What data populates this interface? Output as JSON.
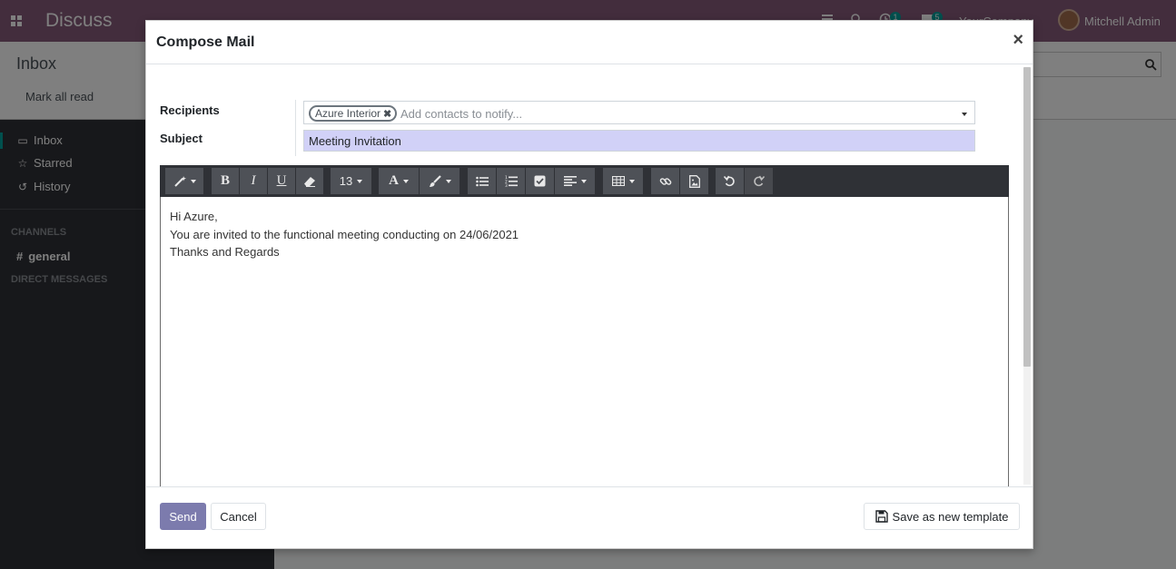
{
  "app": {
    "title": "Discuss",
    "company": "YourCompany",
    "user_name": "Mitchell Admin",
    "activity_count": "1",
    "messages_count": "5"
  },
  "control_panel": {
    "title": "Inbox",
    "mark_all_read": "Mark all read"
  },
  "sidebar": {
    "items": [
      {
        "label": "Inbox",
        "icon": "inbox-icon"
      },
      {
        "label": "Starred",
        "icon": "star-icon"
      },
      {
        "label": "History",
        "icon": "history-icon"
      }
    ],
    "channels_header": "CHANNELS",
    "channel": "general",
    "dm_header": "DIRECT MESSAGES"
  },
  "modal": {
    "title": "Compose Mail",
    "close_glyph": "×",
    "recipients_label": "Recipients",
    "recipient_tag": "Azure Interior",
    "recipients_placeholder": "Add contacts to notify...",
    "subject_label": "Subject",
    "subject_value": "Meeting Invitation",
    "font_size": "13",
    "body_lines": [
      "Hi Azure,",
      "You are invited to the functional meeting conducting on 24/06/2021",
      "Thanks and Regards"
    ],
    "send_label": "Send",
    "cancel_label": "Cancel",
    "save_template_label": "Save as new template"
  },
  "colors": {
    "brand": "#875a7b",
    "primary_button": "#7c7bad",
    "subject_highlight": "#d1d1f7",
    "toolbar_bg": "#2f3136"
  }
}
